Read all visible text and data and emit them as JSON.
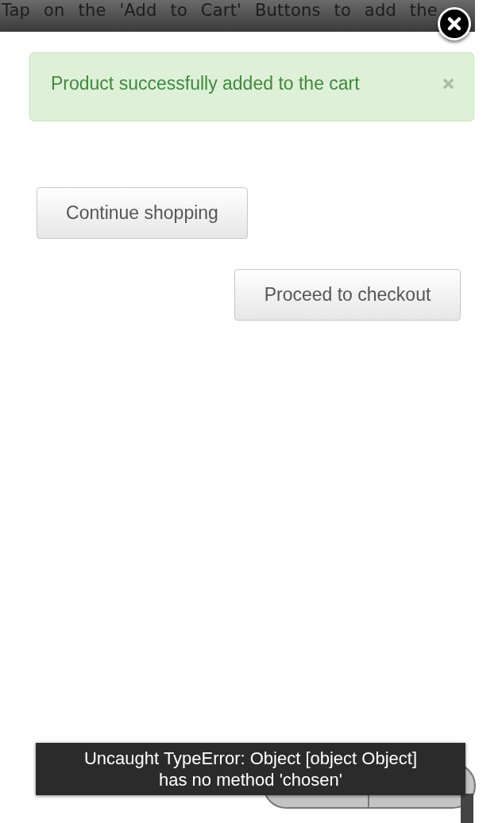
{
  "header": {
    "text": "Tap on the 'Add to Cart' Buttons to add the"
  },
  "alert": {
    "message": "Product successfully added to the cart"
  },
  "buttons": [
    {
      "label": "Continue shopping"
    },
    {
      "label": "Proceed to checkout"
    }
  ],
  "toast": {
    "message": "Uncaught TypeError: Object [object Object] has no method 'chosen'"
  }
}
